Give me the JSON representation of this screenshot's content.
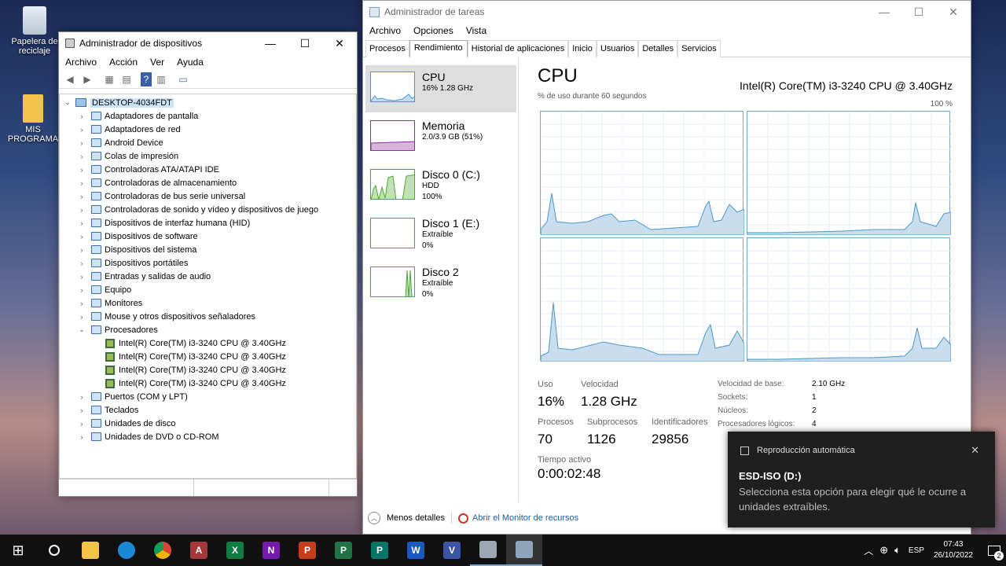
{
  "desktop": {
    "recycle_label": "Papelera de reciclaje",
    "folder_label": "MIS PROGRAMA"
  },
  "devmgr": {
    "title": "Administrador de dispositivos",
    "menu": [
      "Archivo",
      "Acción",
      "Ver",
      "Ayuda"
    ],
    "root": "DESKTOP-4034FDT",
    "items": [
      "Adaptadores de pantalla",
      "Adaptadores de red",
      "Android Device",
      "Colas de impresión",
      "Controladoras ATA/ATAPI IDE",
      "Controladoras de almacenamiento",
      "Controladoras de bus serie universal",
      "Controladoras de sonido y vídeo y dispositivos de juego",
      "Dispositivos de interfaz humana (HID)",
      "Dispositivos de software",
      "Dispositivos del sistema",
      "Dispositivos portátiles",
      "Entradas y salidas de audio",
      "Equipo",
      "Monitores",
      "Mouse y otros dispositivos señaladores",
      "Procesadores"
    ],
    "processors": [
      "Intel(R) Core(TM) i3-3240 CPU @ 3.40GHz",
      "Intel(R) Core(TM) i3-3240 CPU @ 3.40GHz",
      "Intel(R) Core(TM) i3-3240 CPU @ 3.40GHz",
      "Intel(R) Core(TM) i3-3240 CPU @ 3.40GHz"
    ],
    "items_after": [
      "Puertos (COM y LPT)",
      "Teclados",
      "Unidades de disco",
      "Unidades de DVD o CD-ROM"
    ]
  },
  "taskmgr": {
    "title": "Administrador de tareas",
    "menu": [
      "Archivo",
      "Opciones",
      "Vista"
    ],
    "tabs": [
      "Procesos",
      "Rendimiento",
      "Historial de aplicaciones",
      "Inicio",
      "Usuarios",
      "Detalles",
      "Servicios"
    ],
    "resources": [
      {
        "name": "CPU",
        "sub1": "16% 1.28 GHz",
        "sub2": "",
        "color": "#4a98c9"
      },
      {
        "name": "Memoria",
        "sub1": "2.0/3.9 GB (51%)",
        "sub2": "",
        "color": "#8b2d9c"
      },
      {
        "name": "Disco 0 (C:)",
        "sub1": "HDD",
        "sub2": "100%",
        "color": "#4da832"
      },
      {
        "name": "Disco 1 (E:)",
        "sub1": "Extraíble",
        "sub2": "0%",
        "color": "#4da832"
      },
      {
        "name": "Disco 2",
        "sub1": "Extraíble",
        "sub2": "0%",
        "color": "#4da832"
      }
    ],
    "cpu_title": "CPU",
    "cpu_model": "Intel(R) Core(TM) i3-3240 CPU @ 3.40GHz",
    "graph_caption": "% de uso durante 60 segundos",
    "graph_max": "100 %",
    "stats": {
      "uso_label": "Uso",
      "uso": "16%",
      "vel_label": "Velocidad",
      "vel": "1.28 GHz",
      "proc_label": "Procesos",
      "proc": "70",
      "sub_label": "Subprocesos",
      "sub": "1126",
      "ident_label": "Identificadores",
      "ident": "29856",
      "tiempo_label": "Tiempo activo",
      "tiempo": "0:00:02:48"
    },
    "specs": [
      {
        "k": "Velocidad de base:",
        "v": "2.10 GHz"
      },
      {
        "k": "Sockets:",
        "v": "1"
      },
      {
        "k": "Núcleos:",
        "v": "2"
      },
      {
        "k": "Procesadores lógicos:",
        "v": "4"
      }
    ],
    "less_details": "Menos detalles",
    "resmon": "Abrir el Monitor de recursos"
  },
  "toast": {
    "app": "Reproducción automática",
    "title": "ESD-ISO (D:)",
    "body": "Selecciona esta opción para elegir qué le ocurre a unidades extraíbles."
  },
  "taskbar": {
    "lang": "ESP",
    "time": "07:43",
    "date": "26/10/2022",
    "notif_count": "2"
  }
}
